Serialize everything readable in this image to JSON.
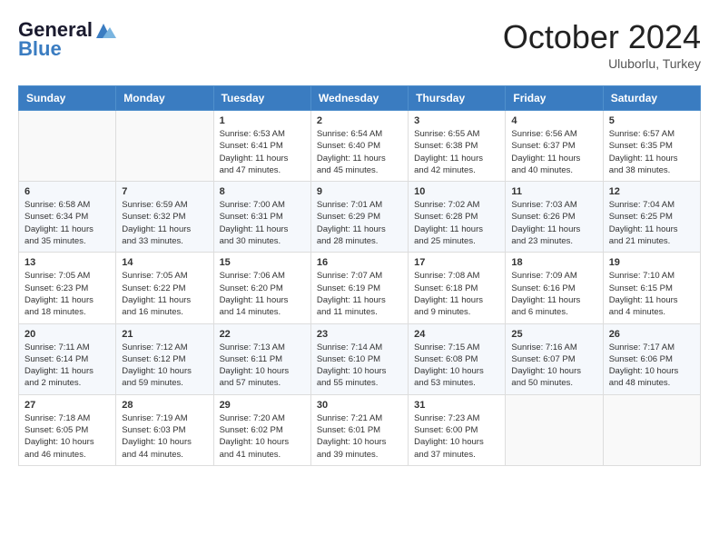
{
  "header": {
    "logo_line1": "General",
    "logo_line2": "Blue",
    "month": "October 2024",
    "location": "Uluborlu, Turkey"
  },
  "weekdays": [
    "Sunday",
    "Monday",
    "Tuesday",
    "Wednesday",
    "Thursday",
    "Friday",
    "Saturday"
  ],
  "weeks": [
    [
      {
        "day": "",
        "info": ""
      },
      {
        "day": "",
        "info": ""
      },
      {
        "day": "1",
        "info": "Sunrise: 6:53 AM\nSunset: 6:41 PM\nDaylight: 11 hours and 47 minutes."
      },
      {
        "day": "2",
        "info": "Sunrise: 6:54 AM\nSunset: 6:40 PM\nDaylight: 11 hours and 45 minutes."
      },
      {
        "day": "3",
        "info": "Sunrise: 6:55 AM\nSunset: 6:38 PM\nDaylight: 11 hours and 42 minutes."
      },
      {
        "day": "4",
        "info": "Sunrise: 6:56 AM\nSunset: 6:37 PM\nDaylight: 11 hours and 40 minutes."
      },
      {
        "day": "5",
        "info": "Sunrise: 6:57 AM\nSunset: 6:35 PM\nDaylight: 11 hours and 38 minutes."
      }
    ],
    [
      {
        "day": "6",
        "info": "Sunrise: 6:58 AM\nSunset: 6:34 PM\nDaylight: 11 hours and 35 minutes."
      },
      {
        "day": "7",
        "info": "Sunrise: 6:59 AM\nSunset: 6:32 PM\nDaylight: 11 hours and 33 minutes."
      },
      {
        "day": "8",
        "info": "Sunrise: 7:00 AM\nSunset: 6:31 PM\nDaylight: 11 hours and 30 minutes."
      },
      {
        "day": "9",
        "info": "Sunrise: 7:01 AM\nSunset: 6:29 PM\nDaylight: 11 hours and 28 minutes."
      },
      {
        "day": "10",
        "info": "Sunrise: 7:02 AM\nSunset: 6:28 PM\nDaylight: 11 hours and 25 minutes."
      },
      {
        "day": "11",
        "info": "Sunrise: 7:03 AM\nSunset: 6:26 PM\nDaylight: 11 hours and 23 minutes."
      },
      {
        "day": "12",
        "info": "Sunrise: 7:04 AM\nSunset: 6:25 PM\nDaylight: 11 hours and 21 minutes."
      }
    ],
    [
      {
        "day": "13",
        "info": "Sunrise: 7:05 AM\nSunset: 6:23 PM\nDaylight: 11 hours and 18 minutes."
      },
      {
        "day": "14",
        "info": "Sunrise: 7:05 AM\nSunset: 6:22 PM\nDaylight: 11 hours and 16 minutes."
      },
      {
        "day": "15",
        "info": "Sunrise: 7:06 AM\nSunset: 6:20 PM\nDaylight: 11 hours and 14 minutes."
      },
      {
        "day": "16",
        "info": "Sunrise: 7:07 AM\nSunset: 6:19 PM\nDaylight: 11 hours and 11 minutes."
      },
      {
        "day": "17",
        "info": "Sunrise: 7:08 AM\nSunset: 6:18 PM\nDaylight: 11 hours and 9 minutes."
      },
      {
        "day": "18",
        "info": "Sunrise: 7:09 AM\nSunset: 6:16 PM\nDaylight: 11 hours and 6 minutes."
      },
      {
        "day": "19",
        "info": "Sunrise: 7:10 AM\nSunset: 6:15 PM\nDaylight: 11 hours and 4 minutes."
      }
    ],
    [
      {
        "day": "20",
        "info": "Sunrise: 7:11 AM\nSunset: 6:14 PM\nDaylight: 11 hours and 2 minutes."
      },
      {
        "day": "21",
        "info": "Sunrise: 7:12 AM\nSunset: 6:12 PM\nDaylight: 10 hours and 59 minutes."
      },
      {
        "day": "22",
        "info": "Sunrise: 7:13 AM\nSunset: 6:11 PM\nDaylight: 10 hours and 57 minutes."
      },
      {
        "day": "23",
        "info": "Sunrise: 7:14 AM\nSunset: 6:10 PM\nDaylight: 10 hours and 55 minutes."
      },
      {
        "day": "24",
        "info": "Sunrise: 7:15 AM\nSunset: 6:08 PM\nDaylight: 10 hours and 53 minutes."
      },
      {
        "day": "25",
        "info": "Sunrise: 7:16 AM\nSunset: 6:07 PM\nDaylight: 10 hours and 50 minutes."
      },
      {
        "day": "26",
        "info": "Sunrise: 7:17 AM\nSunset: 6:06 PM\nDaylight: 10 hours and 48 minutes."
      }
    ],
    [
      {
        "day": "27",
        "info": "Sunrise: 7:18 AM\nSunset: 6:05 PM\nDaylight: 10 hours and 46 minutes."
      },
      {
        "day": "28",
        "info": "Sunrise: 7:19 AM\nSunset: 6:03 PM\nDaylight: 10 hours and 44 minutes."
      },
      {
        "day": "29",
        "info": "Sunrise: 7:20 AM\nSunset: 6:02 PM\nDaylight: 10 hours and 41 minutes."
      },
      {
        "day": "30",
        "info": "Sunrise: 7:21 AM\nSunset: 6:01 PM\nDaylight: 10 hours and 39 minutes."
      },
      {
        "day": "31",
        "info": "Sunrise: 7:23 AM\nSunset: 6:00 PM\nDaylight: 10 hours and 37 minutes."
      },
      {
        "day": "",
        "info": ""
      },
      {
        "day": "",
        "info": ""
      }
    ]
  ]
}
